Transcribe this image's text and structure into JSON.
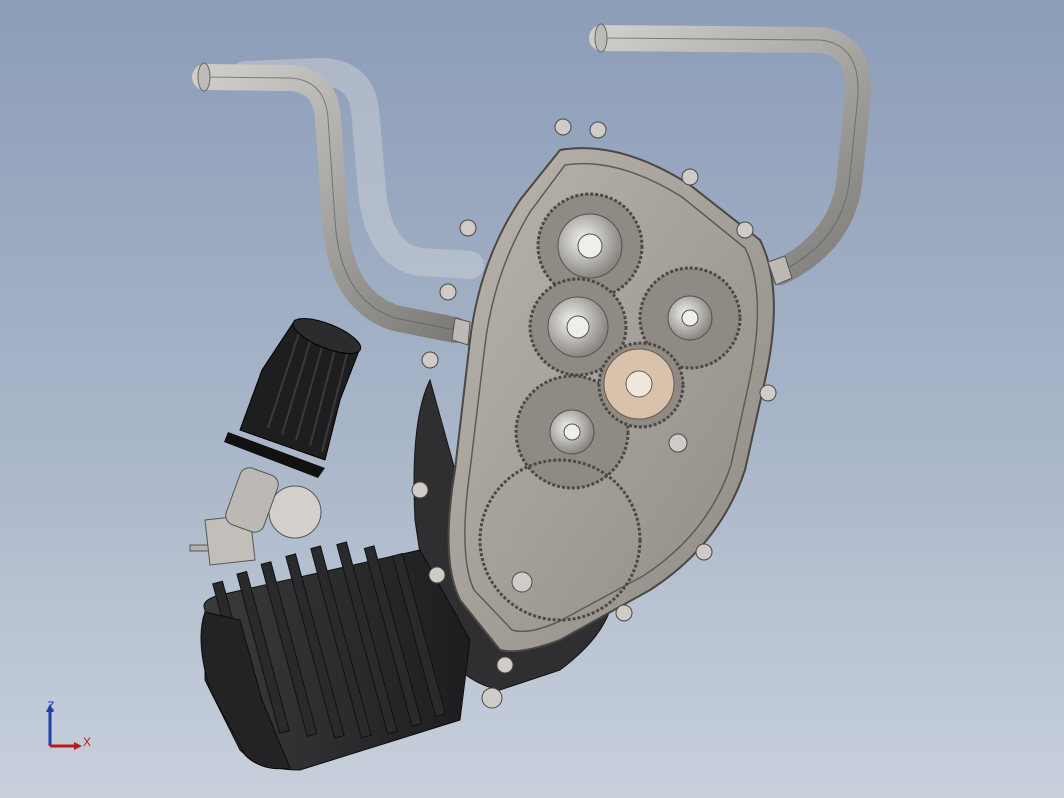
{
  "viewport": {
    "background_top": "#8c9db8",
    "background_bottom": "#c8d0dc"
  },
  "triad": {
    "z_label": "Z",
    "x_label": "X",
    "z_color": "#1f3fa8",
    "x_color": "#b21e1e"
  },
  "model": {
    "case_color": "#a7a39c",
    "gear_color": "#8f8b84",
    "pipe_color": "#a9a7a3",
    "cylinder_color": "#2b2b2d",
    "filter_color": "#1e1e20",
    "pinion_color": "#d8c2ac"
  }
}
